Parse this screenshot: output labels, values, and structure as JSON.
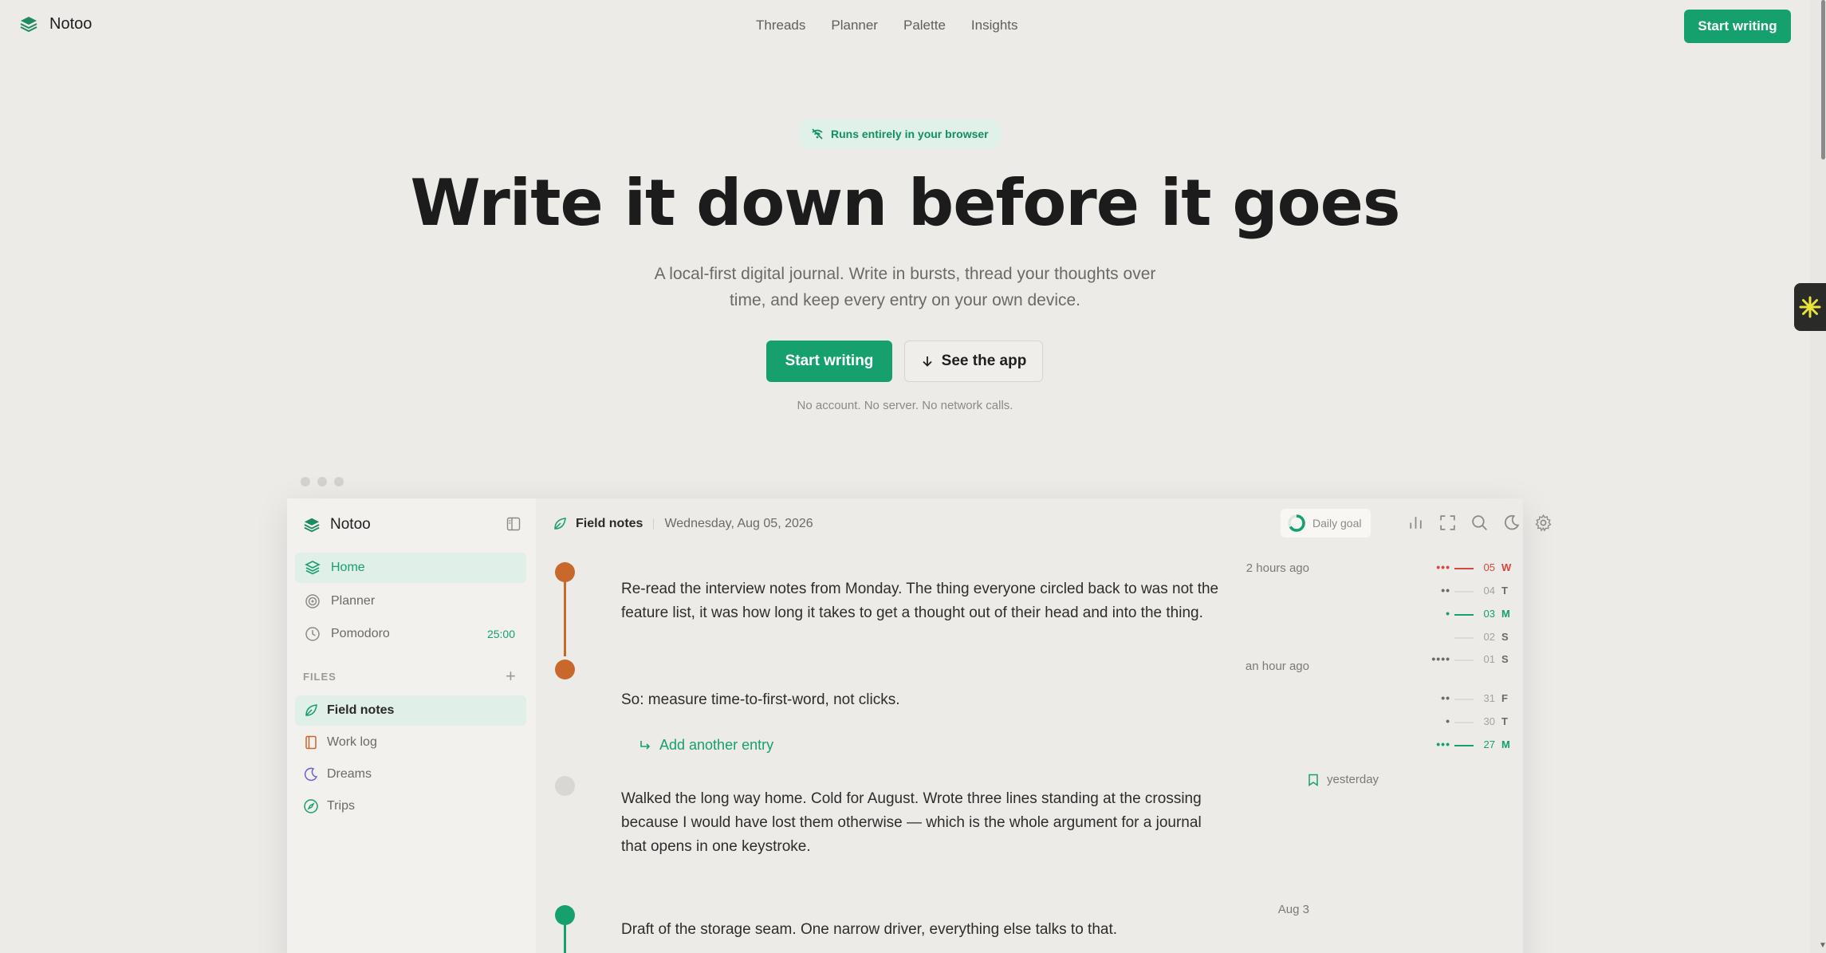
{
  "brand": {
    "name": "Notoo"
  },
  "nav": [
    "Threads",
    "Planner",
    "Palette",
    "Insights"
  ],
  "top_cta": "Start writing",
  "hero": {
    "badge": "Runs entirely in your browser",
    "title": "Write it down before it goes",
    "subtitle_line1": "A local-first digital journal. Write in bursts, thread your thoughts over",
    "subtitle_line2": "time, and keep every entry on your own device.",
    "primary_button": "Start writing",
    "secondary_button": "See the app",
    "note": "No account. No server. No network calls."
  },
  "app": {
    "sidebar": {
      "brand": "Notoo",
      "items": [
        {
          "label": "Home",
          "icon": "layers-icon",
          "active": true
        },
        {
          "label": "Planner",
          "icon": "target-icon"
        },
        {
          "label": "Pomodoro",
          "icon": "clock-icon",
          "time": "25:00"
        }
      ],
      "files_heading": "FILES",
      "files": [
        {
          "label": "Field notes",
          "icon": "leaf-icon",
          "active": true
        },
        {
          "label": "Work log",
          "icon": "notebook-icon"
        },
        {
          "label": "Dreams",
          "icon": "moon-icon"
        },
        {
          "label": "Trips",
          "icon": "compass-icon"
        }
      ]
    },
    "header": {
      "file": "Field notes",
      "date": "Wednesday, Aug 05, 2026",
      "daily_goal": "Daily goal"
    },
    "entries": [
      {
        "time": "2 hours ago",
        "lines": [
          "Re-read the interview notes from Monday. The thing everyone circled back to was not the",
          "feature list, it was how long it takes to get a thought out of their head and into the thing."
        ]
      },
      {
        "time": "an hour ago",
        "lines": [
          "So: measure time-to-first-word, not clicks."
        ]
      },
      {
        "time": "yesterday",
        "lines": [
          "Walked the long way home. Cold for August. Wrote three lines standing at the crossing",
          "because I would have lost them otherwise — which is the whole argument for a journal",
          "that opens in one keystroke."
        ]
      },
      {
        "time": "Aug 3",
        "lines": [
          "Draft of the storage seam. One narrow driver, everything else talks to that."
        ]
      }
    ],
    "add_entry": "Add another entry",
    "streak": [
      {
        "dots": "•••",
        "num": "05",
        "day": "W",
        "color": "#d9463b",
        "line": true
      },
      {
        "dots": "••",
        "num": "04",
        "day": "T",
        "color": "#6a6a66",
        "line": false
      },
      {
        "dots": "•",
        "num": "03",
        "day": "M",
        "color": "#16a06d",
        "line": true
      },
      {
        "dots": "",
        "num": "02",
        "day": "S",
        "color": "#6a6a66",
        "line": false
      },
      {
        "dots": "••••",
        "num": "01",
        "day": "S",
        "color": "#6a6a66",
        "line": false
      },
      {
        "dots": "••",
        "num": "31",
        "day": "F",
        "color": "#6a6a66",
        "line": false
      },
      {
        "dots": "•",
        "num": "30",
        "day": "T",
        "color": "#6a6a66",
        "line": false
      },
      {
        "dots": "•••",
        "num": "27",
        "day": "M",
        "color": "#16a06d",
        "line": true
      }
    ]
  },
  "colors": {
    "accent": "#16a06d",
    "orange": "#c8692b",
    "red": "#d9463b",
    "background": "#ecebe8"
  }
}
